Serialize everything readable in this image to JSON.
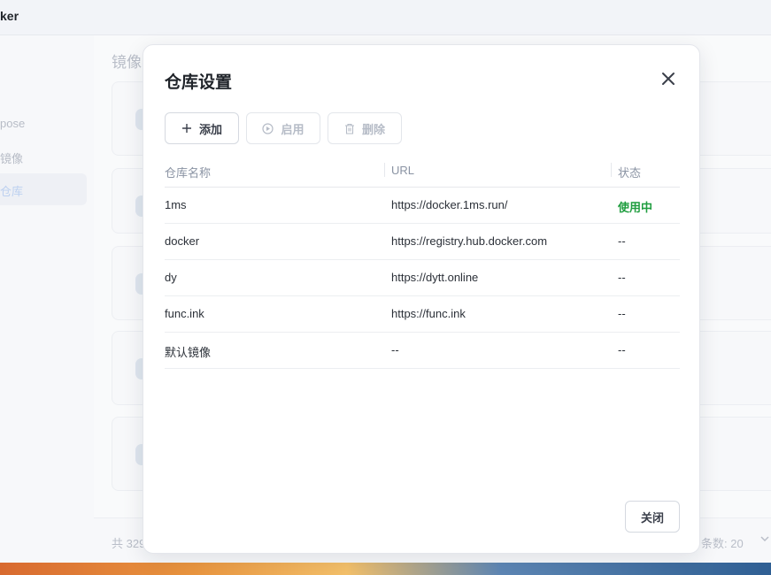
{
  "app": {
    "title_fragment": "ker",
    "sidebar_items": [
      "pose",
      "镜像",
      "仓库"
    ],
    "content_title": "镜像",
    "footer_left": "共 329",
    "footer_right": "条数: 20"
  },
  "modal": {
    "title": "仓库设置",
    "toolbar": {
      "add_label": "添加",
      "enable_label": "启用",
      "delete_label": "删除"
    },
    "columns": [
      "仓库名称",
      "URL",
      "状态"
    ],
    "rows": [
      {
        "name": "1ms",
        "url": "https://docker.1ms.run/",
        "status": "使用中"
      },
      {
        "name": "docker",
        "url": "https://registry.hub.docker.com",
        "status": "--"
      },
      {
        "name": "dy",
        "url": "https://dytt.online",
        "status": "--"
      },
      {
        "name": "func.ink",
        "url": "https://func.ink",
        "status": "--"
      },
      {
        "name": "默认镜像",
        "url": "--",
        "status": "--"
      }
    ],
    "close_label": "关闭"
  },
  "colors": {
    "status_active": "#1f9d3f",
    "muted_text": "#8a93a3"
  }
}
